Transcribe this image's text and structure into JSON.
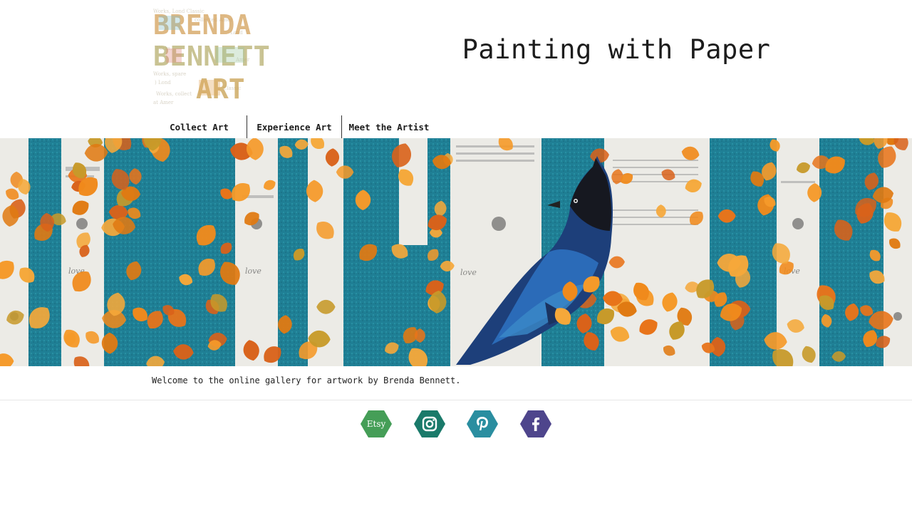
{
  "header": {
    "logo_lines": [
      "BRENDA",
      "BENNETT",
      "ART"
    ],
    "site_title": "Painting with Paper"
  },
  "nav": {
    "items": [
      {
        "label": "Collect Art"
      },
      {
        "label": "Experience Art"
      },
      {
        "label": "Meet the Artist"
      }
    ]
  },
  "hero": {
    "alt": "Collage painting of aspen trees with orange leaves and a Steller's jay",
    "background_script": [
      "love",
      "love",
      "love",
      "love"
    ]
  },
  "main": {
    "welcome_text": "Welcome to the online gallery for artwork by Brenda Bennett."
  },
  "social": {
    "links": [
      {
        "name": "Etsy",
        "icon": "etsy-icon",
        "label": "Etsy",
        "color": "#2f8c5a"
      },
      {
        "name": "Instagram",
        "icon": "instagram-icon",
        "color": "#1a7a6a"
      },
      {
        "name": "Pinterest",
        "icon": "pinterest-icon",
        "color": "#2a8ea0"
      },
      {
        "name": "Facebook",
        "icon": "facebook-icon",
        "color": "#5a2e7a"
      }
    ]
  },
  "colors": {
    "teal": "#1f7f95",
    "orange": "#f08a1c",
    "birch_white": "#ecebe6",
    "text": "#1c1c1c"
  }
}
